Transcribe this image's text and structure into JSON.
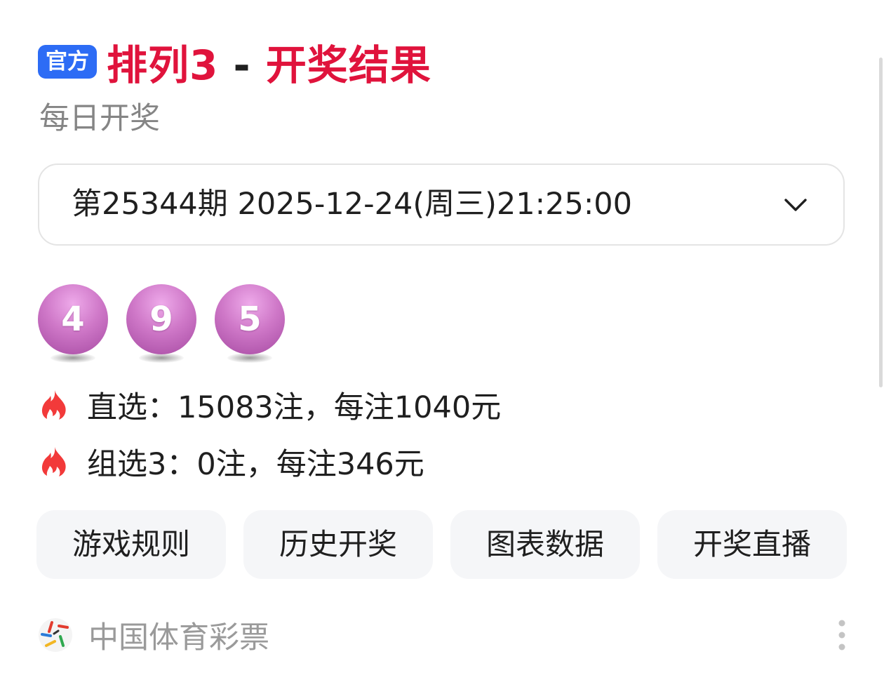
{
  "header": {
    "badge": "官方",
    "title_game": "排列3",
    "title_sep": " - ",
    "title_suffix": "开奖结果"
  },
  "subtitle": "每日开奖",
  "issue_select": {
    "value": "第25344期 2025-12-24(周三)21:25:00",
    "icon": "chevron-down-icon"
  },
  "draw_numbers": [
    "4",
    "9",
    "5"
  ],
  "prizes": [
    {
      "icon": "fire-icon",
      "text": "直选：15083注，每注1040元"
    },
    {
      "icon": "fire-icon",
      "text": "组选3：0注，每注346元"
    }
  ],
  "actions": [
    {
      "label": "游戏规则"
    },
    {
      "label": "历史开奖"
    },
    {
      "label": "图表数据"
    },
    {
      "label": "开奖直播"
    }
  ],
  "source": {
    "logo": "china-sports-lottery-logo",
    "name": "中国体育彩票",
    "more_icon": "more-vertical-icon"
  },
  "colors": {
    "badge_blue": "#2d6cf5",
    "title_red": "#e0133c",
    "ball_purple": "#cf78c8",
    "fire_red": "#f23a3a",
    "button_bg": "#f5f6f8"
  }
}
